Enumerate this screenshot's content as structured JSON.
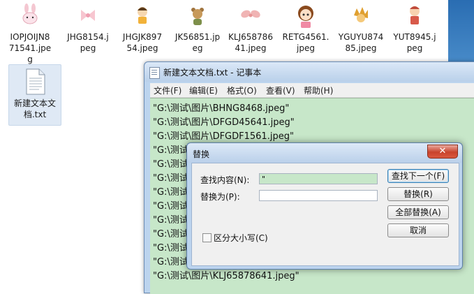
{
  "desktop": {
    "files": [
      {
        "name": "IOPJOIJN871541.jpeg",
        "line1": "IOPJOIJN8",
        "line2": "71541.jpe",
        "line3": "g",
        "thumb": "bunny-thumb"
      },
      {
        "name": "JHG8154.jpeg",
        "line1": "JHG8154.j",
        "line2": "peg",
        "line3": "",
        "thumb": "pink-bow-thumb"
      },
      {
        "name": "JHGJK89754.jpeg",
        "line1": "JHGJK897",
        "line2": "54.jpeg",
        "line3": "",
        "thumb": "boy-thumb"
      },
      {
        "name": "JK56851.jpeg",
        "line1": "JK56851.jp",
        "line2": "eg",
        "line3": "",
        "thumb": "bear-thumb"
      },
      {
        "name": "KLJ65878641.jpeg",
        "line1": "KLJ658786",
        "line2": "41.jpeg",
        "line3": "",
        "thumb": "bow-thumb"
      },
      {
        "name": "RETG4561.jpeg",
        "line1": "RETG4561.",
        "line2": "jpeg",
        "line3": "",
        "thumb": "girl-thumb"
      },
      {
        "name": "YGUYU87485.jpeg",
        "line1": "YGUYU874",
        "line2": "85.jpeg",
        "line3": "",
        "thumb": "hedgehog-thumb"
      },
      {
        "name": "YUT8945.jpeg",
        "line1": "YUT8945.j",
        "line2": "peg",
        "line3": "",
        "thumb": "doll-thumb"
      }
    ],
    "text_file": {
      "line1": "新建文本文",
      "line2": "档.txt"
    }
  },
  "notepad": {
    "title": "新建文本文档.txt - 记事本",
    "menu": [
      "文件(F)",
      "编辑(E)",
      "格式(O)",
      "查看(V)",
      "帮助(H)"
    ],
    "lines": [
      "\"G:\\测试\\图片\\BHNG8468.jpeg\"",
      "\"G:\\测试\\图片\\DFGD45641.jpeg\"",
      "\"G:\\测试\\图片\\DFGDF1561.jpeg\"",
      "\"G:\\测试",
      "\"G:\\测试",
      "\"G:\\测试",
      "\"G:\\测试",
      "\"G:\\测试",
      "\"G:\\测试",
      "\"G:\\测试",
      "\"G:\\测试",
      "\"G:\\测试",
      "\"G:\\测试\\图片\\KLJ65878641.jpeg\""
    ]
  },
  "replace_dialog": {
    "title": "替换",
    "close": "✕",
    "find_label": "查找内容(N):",
    "find_value": "\"",
    "replace_label": "替换为(P):",
    "replace_value": "",
    "match_case_label": "区分大小写(C)",
    "buttons": {
      "find_next": "查找下一个(F)",
      "replace": "替换(R)",
      "replace_all": "全部替换(A)",
      "cancel": "取消"
    }
  }
}
